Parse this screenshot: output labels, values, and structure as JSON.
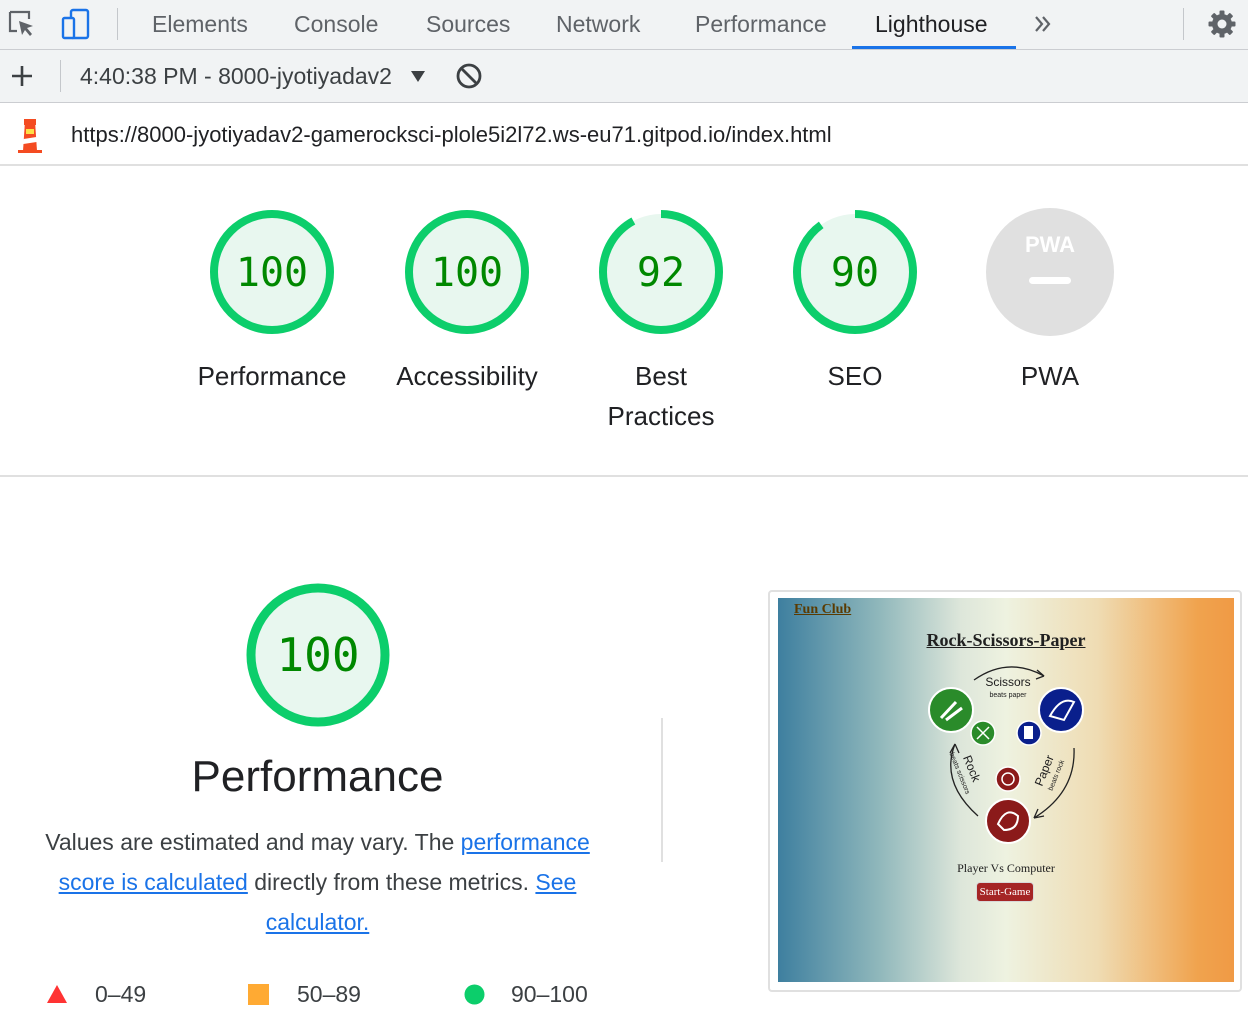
{
  "devtools": {
    "tabs": [
      {
        "label": "Elements"
      },
      {
        "label": "Console"
      },
      {
        "label": "Sources"
      },
      {
        "label": "Network"
      },
      {
        "label": "Performance"
      },
      {
        "label": "Lighthouse"
      }
    ],
    "active_tab": "Lighthouse",
    "icons": [
      "inspect-element-icon",
      "device-toolbar-icon",
      "more-tabs-icon",
      "settings-gear-icon"
    ]
  },
  "toolbar": {
    "report_selector": "4:40:38 PM - 8000-jyotiyadav2",
    "icons": [
      "add-icon",
      "dropdown-arrow-icon",
      "clear-icon"
    ]
  },
  "url_bar": {
    "url": "https://8000-jyotiyadav2-gamerocksci-plole5i2l72.ws-eu71.gitpod.io/index.html",
    "icon": "lighthouse-icon"
  },
  "gauges": [
    {
      "score": "100",
      "label": "Performance",
      "fraction": 1.0
    },
    {
      "score": "100",
      "label": "Accessibility",
      "fraction": 1.0
    },
    {
      "score": "92",
      "label": "Best Practices",
      "fraction": 0.92
    },
    {
      "score": "90",
      "label": "SEO",
      "fraction": 0.9
    },
    {
      "score": "PWA",
      "label": "PWA",
      "fraction": null
    }
  ],
  "main": {
    "score": "100",
    "fraction": 1.0,
    "title": "Performance",
    "desc_part1": "Values are estimated and may vary. The ",
    "desc_link1": "performance score is calculated",
    "desc_part2": " directly from these metrics. ",
    "desc_link2": "See calculator.",
    "legend": [
      {
        "range": "0–49",
        "color": "#ff3333"
      },
      {
        "range": "50–89",
        "color": "#ffaa33"
      },
      {
        "range": "90–100",
        "color": "#0cce6b"
      }
    ]
  },
  "screenshot": {
    "club": "Fun Club",
    "title": "Rock-Scissors-Paper",
    "scissors_label": "Scissors",
    "scissors_sub": "beats paper",
    "rock_label": "Rock",
    "rock_sub": "beats scissors",
    "paper_label": "Paper",
    "paper_sub": "beats rock",
    "subtitle": "Player Vs Computer",
    "button": "Start-Game"
  },
  "colors": {
    "pass_stroke": "#0cce6b",
    "pass_fill": "#e8f7ef",
    "pass_text": "#008800",
    "na_fill": "#e0e0e0",
    "accent": "#1a73e8"
  }
}
